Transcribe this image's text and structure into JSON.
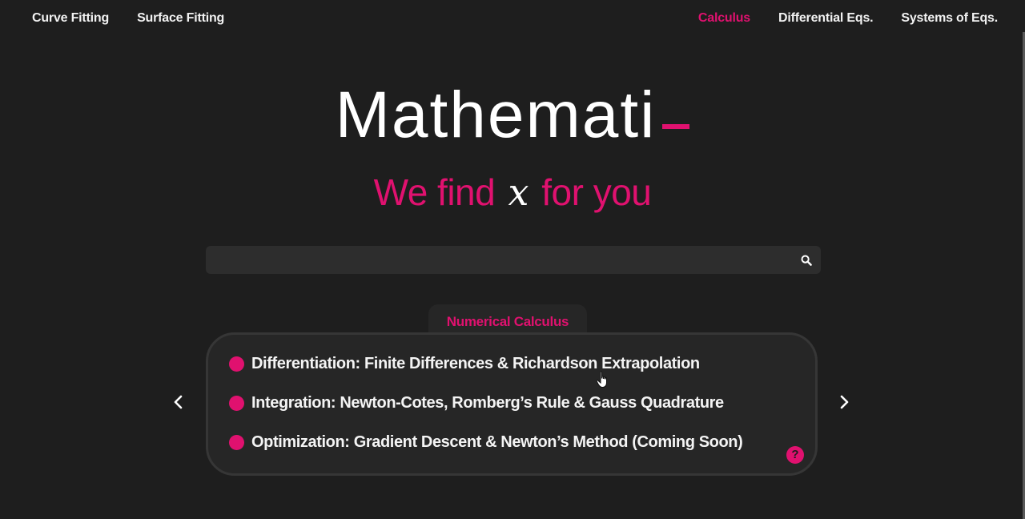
{
  "nav": {
    "left": [
      "Curve Fitting",
      "Surface Fitting"
    ],
    "right": [
      "Calculus",
      "Differential Eqs.",
      "Systems of Eqs."
    ],
    "active": "Calculus"
  },
  "hero": {
    "title": "Mathemati",
    "tagline_before": "We find",
    "tagline_var": "x",
    "tagline_after": "for you"
  },
  "search": {
    "value": "",
    "placeholder": "",
    "icon": "search-icon"
  },
  "card": {
    "heading": "Numerical Calculus",
    "items": [
      "Differentiation: Finite Differences & Richardson Extrapolation",
      "Integration: Newton-Cotes, Romberg’s Rule & Gauss Quadrature",
      "Optimization: Gradient Descent & Newton’s Method (Coming Soon)"
    ],
    "help_label": "?"
  },
  "colors": {
    "accent": "#e0116f",
    "background": "#1e1e1e",
    "card": "#262626",
    "search": "#2d2d2d"
  }
}
